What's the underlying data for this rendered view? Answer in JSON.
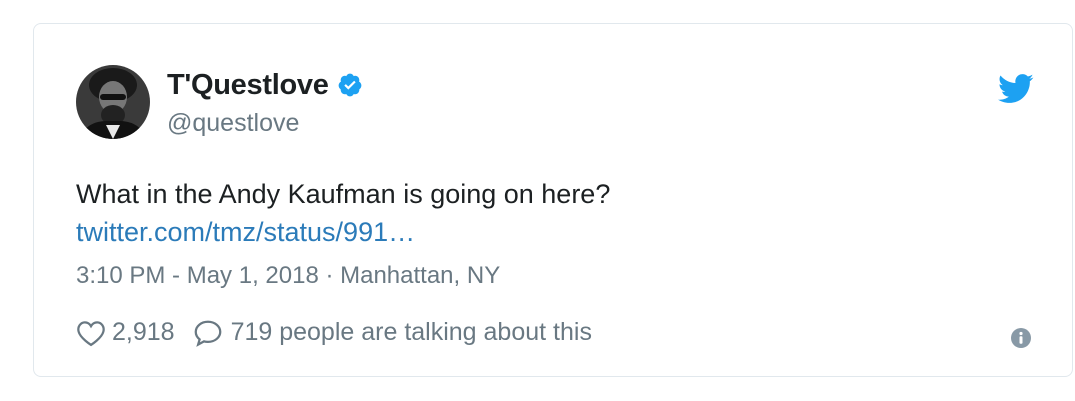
{
  "tweet": {
    "author": {
      "display_name": "T'Questlove",
      "handle": "@questlove",
      "verified": true,
      "avatar_icon": "profile-photo"
    },
    "text": "What in the Andy Kaufman is going on here?",
    "link": "twitter.com/tmz/status/991…",
    "meta": "3:10 PM - May 1, 2018 · Manhattan, NY",
    "likes": "2,918",
    "replies_text": "719 people are talking about this"
  },
  "icons": {
    "brand": "twitter-bird-icon",
    "verified": "verified-badge-icon",
    "like": "heart-icon",
    "reply": "speech-bubble-icon",
    "info": "info-icon"
  },
  "colors": {
    "brand_blue": "#1da1f2",
    "link_blue": "#2b7bb9",
    "text": "#1c2022",
    "muted": "#697882",
    "border": "#e1e8ed"
  }
}
